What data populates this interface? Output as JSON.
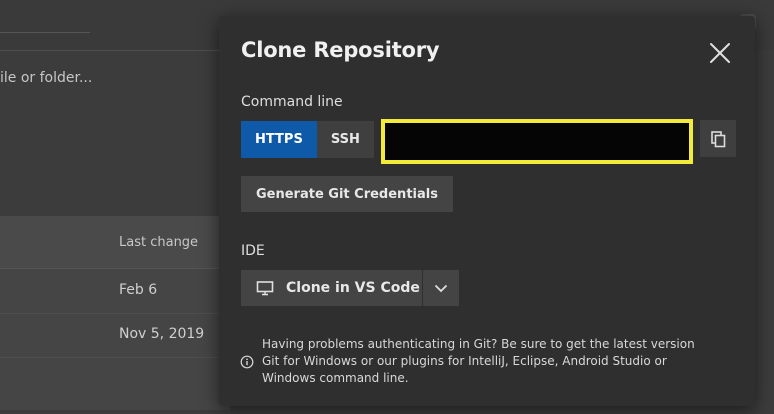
{
  "background": {
    "hint_text": "ile or folder...",
    "table": {
      "column_header": "Last change",
      "rows": [
        {
          "last_change": "Feb 6"
        },
        {
          "last_change": "Nov 5, 2019"
        }
      ]
    }
  },
  "dialog": {
    "title": "Clone Repository",
    "close_icon": "close-icon",
    "command_line": {
      "label": "Command line",
      "protocols": [
        {
          "label": "HTTPS",
          "selected": true
        },
        {
          "label": "SSH",
          "selected": false
        }
      ],
      "url_value": "",
      "copy_icon": "copy-icon"
    },
    "generate_credentials_label": "Generate Git Credentials",
    "ide": {
      "label": "IDE",
      "clone_label": "Clone in VS Code",
      "clone_icon": "monitor-icon",
      "dropdown_icon": "chevron-down-icon"
    },
    "info": {
      "icon": "info-icon",
      "text": "Having problems authenticating in Git? Be sure to get the latest version Git for Windows or our plugins for IntelliJ, Eclipse, Android Studio or Windows command line."
    }
  },
  "colors": {
    "accent": "#0f5aa8",
    "highlight_border": "#f2eb3a",
    "dialog_bg": "#2f2f2f",
    "page_bg": "#3c3c3c"
  }
}
